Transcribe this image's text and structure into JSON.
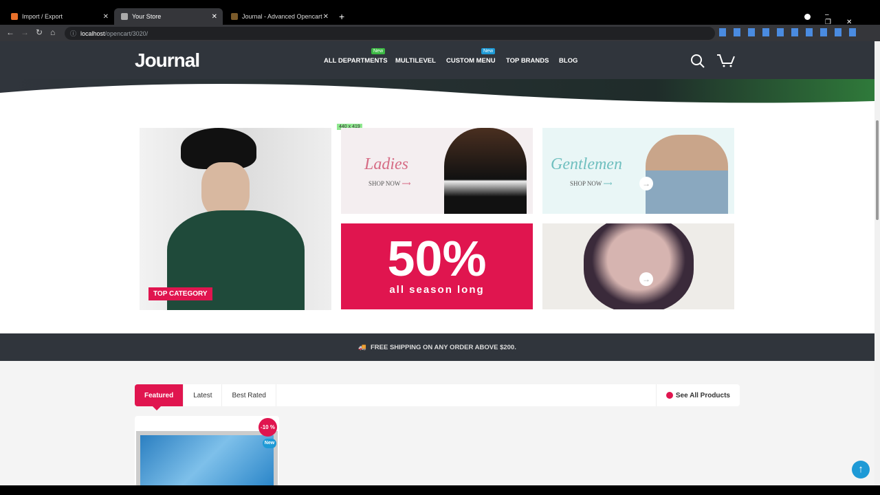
{
  "browser": {
    "tabs": [
      {
        "title": "Import / Export"
      },
      {
        "title": "Your Store",
        "active": true
      },
      {
        "title": "Journal - Advanced Opencart The"
      }
    ],
    "url_host": "localhost",
    "url_path": "/opencart/3020/"
  },
  "header": {
    "logo": "Journal",
    "nav": [
      {
        "label": "ALL DEPARTMENTS",
        "badge": "New",
        "badge_color": "#3cb944"
      },
      {
        "label": "MULTILEVEL"
      },
      {
        "label": "CUSTOM MENU",
        "badge": "New",
        "badge_color": "#1e9ad6"
      },
      {
        "label": "TOP BRANDS"
      },
      {
        "label": "BLOG"
      }
    ]
  },
  "banners": {
    "size_tag": "440 x 419",
    "top_category": "TOP CATEGORY",
    "ladies": "Ladies",
    "gentlemen": "Gentlemen",
    "shop_now": "SHOP NOW",
    "sale_big": "50%",
    "sale_small": "all season long"
  },
  "shipping": {
    "text": "FREE SHIPPING ON ANY ORDER ABOVE $200."
  },
  "products": {
    "tabs": [
      "Featured",
      "Latest",
      "Best Rated"
    ],
    "see_all": "See All Products",
    "discount": "-10 %",
    "new": "New"
  },
  "colors": {
    "accent": "#e0154f",
    "header": "#30353c"
  }
}
